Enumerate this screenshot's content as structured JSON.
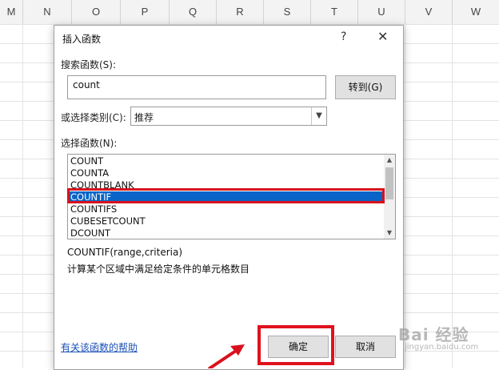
{
  "spreadsheet": {
    "columns": [
      "M",
      "N",
      "O",
      "P",
      "Q",
      "R",
      "S",
      "T",
      "U",
      "V",
      "W"
    ]
  },
  "dialog": {
    "title": "插入函数",
    "help_glyph": "?",
    "close_glyph": "✕",
    "search_label": "搜索函数(S):",
    "search_value": "count",
    "goto_label": "转到(G)",
    "category_label": "或选择类别(C):",
    "category_value": "推荐",
    "function_list_label": "选择函数(N):",
    "functions": [
      "COUNT",
      "COUNTA",
      "COUNTBLANK",
      "COUNTIF",
      "COUNTIFS",
      "CUBESETCOUNT",
      "DCOUNT"
    ],
    "selected_function": "COUNTIF",
    "syntax": "COUNTIF(range,criteria)",
    "description": "计算某个区域中满足给定条件的单元格数目",
    "help_link": "有关该函数的帮助",
    "ok_label": "确定",
    "cancel_label": "取消"
  },
  "watermark": {
    "text": "Bai 经验",
    "sub": "jingyan.baidu.com"
  },
  "colors": {
    "selection": "#0a64c8",
    "highlight_red": "#d8121d",
    "link": "#1a4fb8"
  }
}
